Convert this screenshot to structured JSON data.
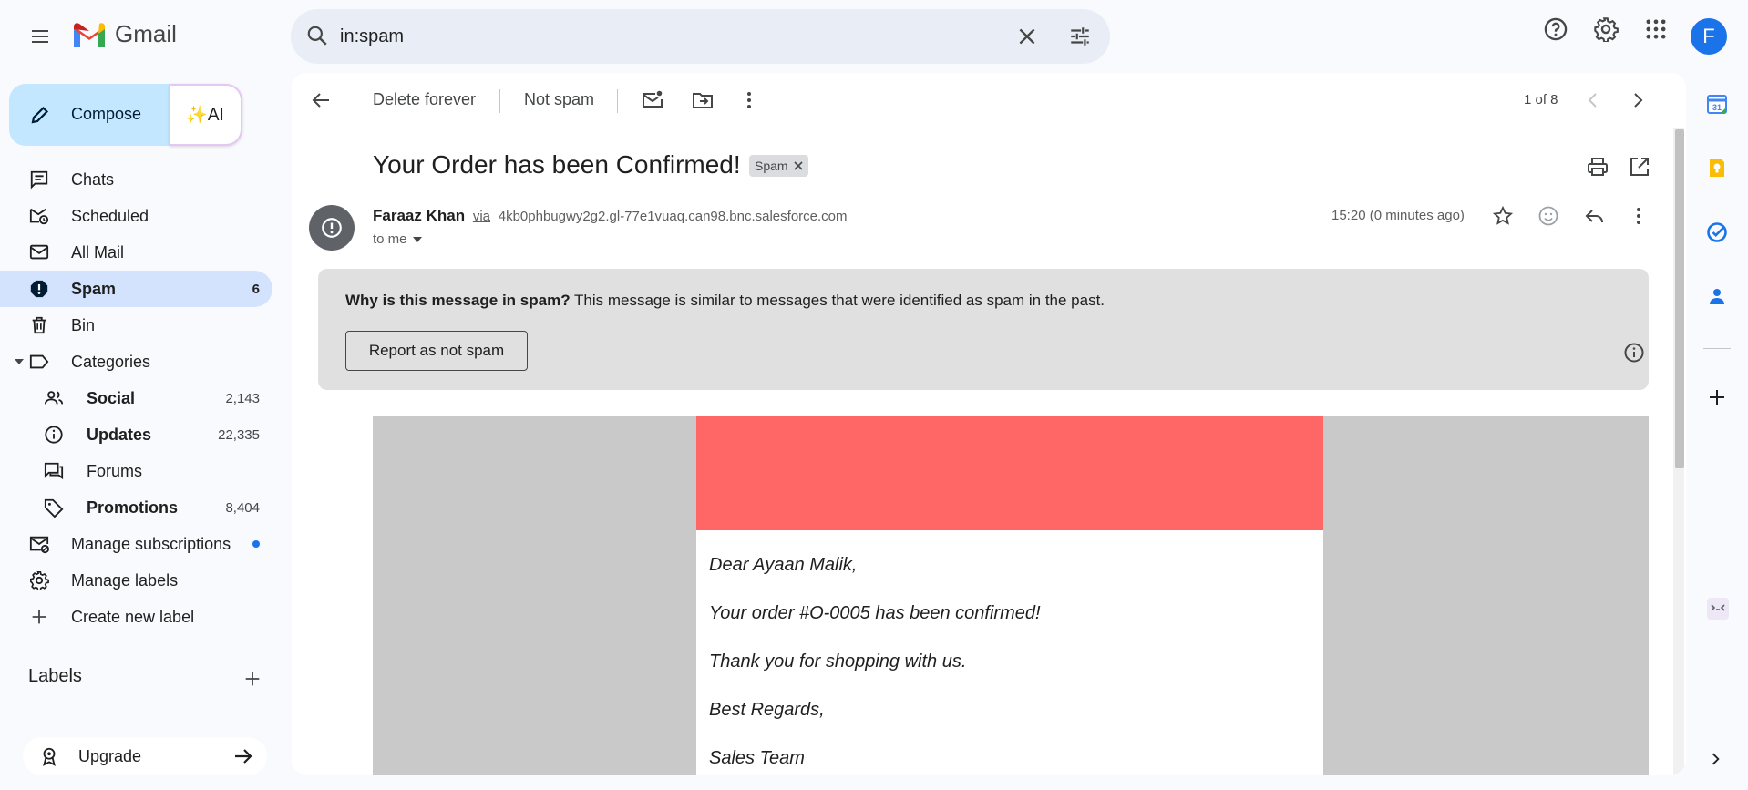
{
  "app": {
    "name": "Gmail"
  },
  "search": {
    "query": "in:spam"
  },
  "account": {
    "initial": "F"
  },
  "compose": {
    "label": "Compose",
    "ai_label": "✨AI"
  },
  "sidebar": {
    "items": [
      {
        "label": "Chats",
        "icon": "chat-icon",
        "count": ""
      },
      {
        "label": "Scheduled",
        "icon": "scheduled-icon",
        "count": ""
      },
      {
        "label": "All Mail",
        "icon": "all-mail-icon",
        "count": ""
      },
      {
        "label": "Spam",
        "icon": "spam-icon",
        "count": "6"
      },
      {
        "label": "Bin",
        "icon": "bin-icon",
        "count": ""
      },
      {
        "label": "Categories",
        "icon": "label-icon",
        "count": ""
      },
      {
        "label": "Social",
        "icon": "social-icon",
        "count": "2,143"
      },
      {
        "label": "Updates",
        "icon": "info-icon",
        "count": "22,335"
      },
      {
        "label": "Forums",
        "icon": "forums-icon",
        "count": ""
      },
      {
        "label": "Promotions",
        "icon": "tag-icon",
        "count": "8,404"
      },
      {
        "label": "Manage subscriptions",
        "icon": "manage-subscriptions-icon",
        "count": ""
      },
      {
        "label": "Manage labels",
        "icon": "gear-icon",
        "count": ""
      },
      {
        "label": "Create new label",
        "icon": "plus-icon",
        "count": ""
      }
    ],
    "labels_heading": "Labels",
    "upgrade_label": "Upgrade"
  },
  "toolbar": {
    "delete_forever": "Delete forever",
    "not_spam": "Not spam",
    "pager": "1 of 8"
  },
  "message": {
    "subject": "Your Order has been Confirmed!",
    "tag": "Spam",
    "sender_name": "Faraaz Khan",
    "via": "via",
    "sender_address": "4kb0phbugwy2g2.gl-77e1vuaq.can98.bnc.salesforce.com",
    "to": "to me",
    "time": "15:20 (0 minutes ago)"
  },
  "spam_warning": {
    "question": "Why is this message in spam?",
    "explanation": " This message is similar to messages that were identified as spam in the past.",
    "button": "Report as not spam"
  },
  "email_body": {
    "banner_color": "#ff6666",
    "lines": [
      "Dear Ayaan Malik,",
      "Your order #O-0005 has been confirmed!",
      "Thank you for shopping with us.",
      "Best Regards,",
      "Sales Team"
    ]
  },
  "colors": {
    "accent": "#1a73e8",
    "active_nav": "#d3e3fd",
    "compose": "#c2e7ff"
  }
}
